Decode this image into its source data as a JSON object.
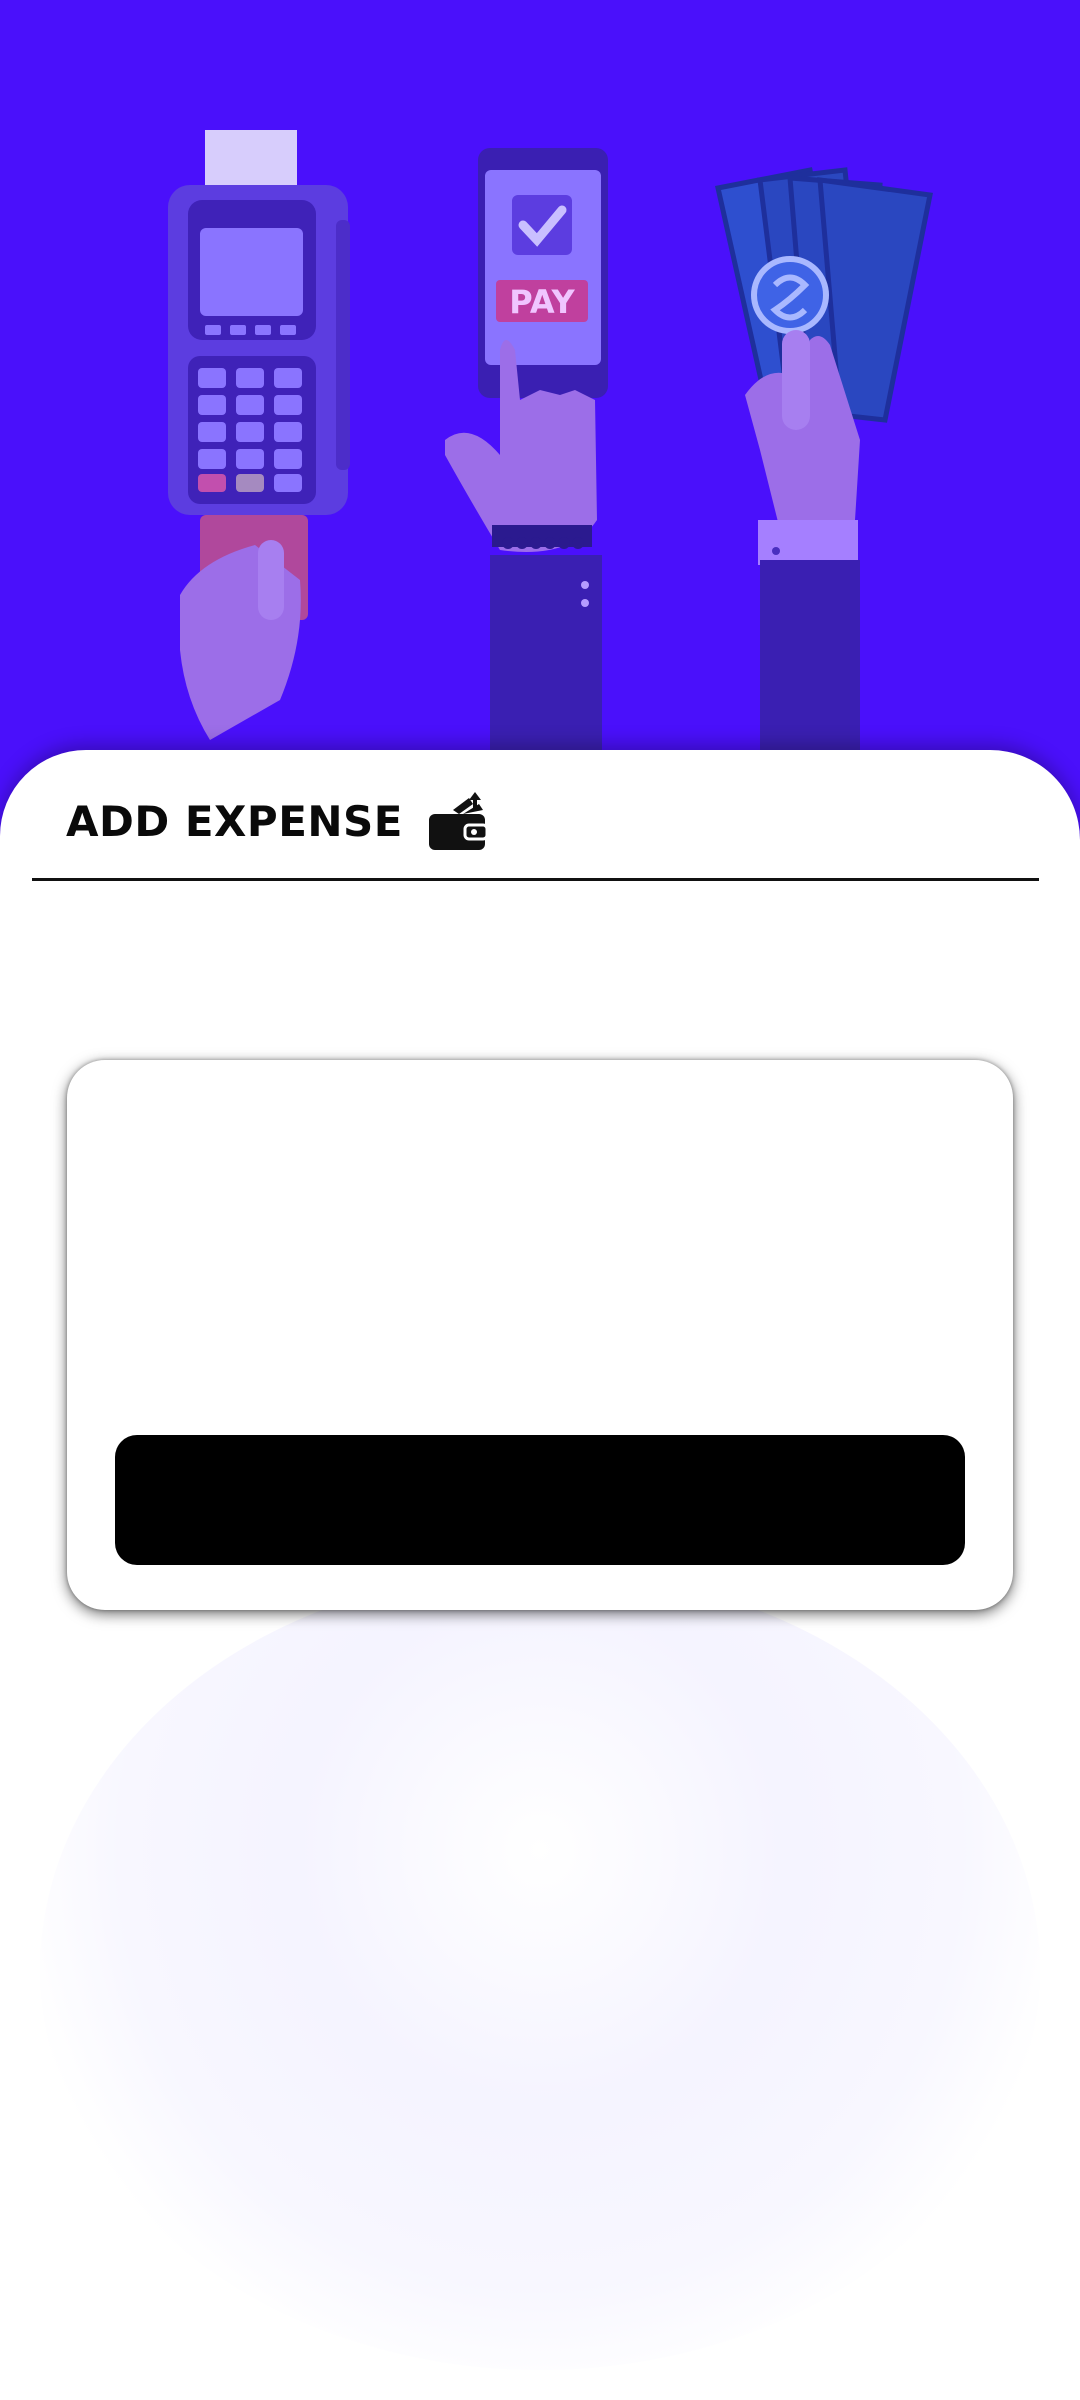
{
  "header": {
    "title": "ADD EXPENSE",
    "icon": "wallet-icon"
  },
  "hero": {
    "illustration": "payment-methods-illustration",
    "pay_label": "PAY"
  },
  "form": {
    "submit_label": ""
  },
  "colors": {
    "hero_background": "#4a10fb",
    "sheet_background": "#ffffff",
    "button_background": "#000000"
  }
}
